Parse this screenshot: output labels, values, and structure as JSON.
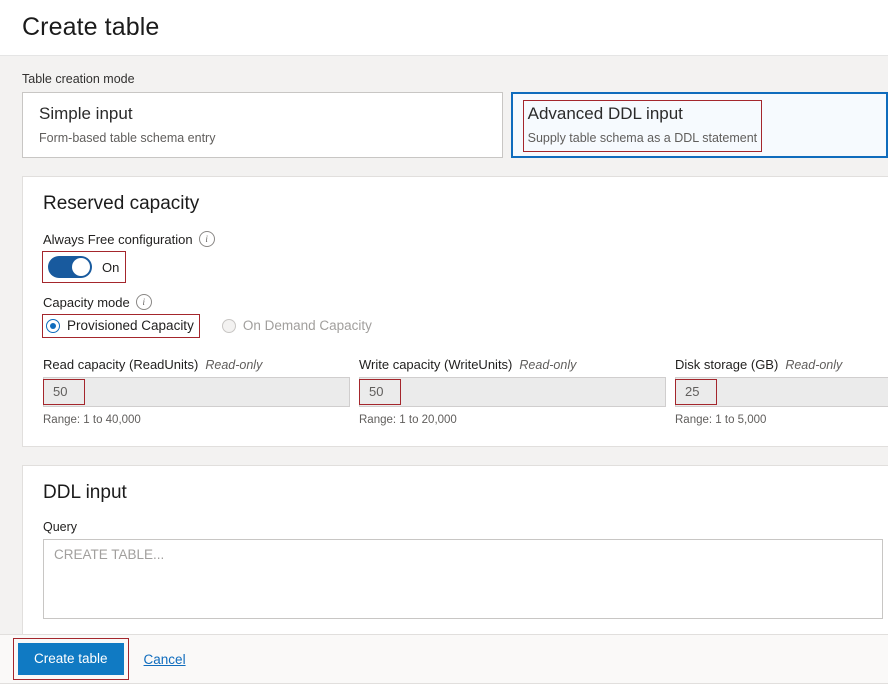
{
  "header": {
    "title": "Create table"
  },
  "mode": {
    "label": "Table creation mode",
    "tiles": [
      {
        "title": "Simple input",
        "subtitle": "Form-based table schema entry",
        "selected": false
      },
      {
        "title": "Advanced DDL input",
        "subtitle": "Supply table schema as a DDL statement",
        "selected": true
      }
    ]
  },
  "reserved_capacity": {
    "title": "Reserved capacity",
    "always_free": {
      "label": "Always Free configuration",
      "info_icon": "info-icon",
      "state": "On"
    },
    "capacity_mode": {
      "label": "Capacity mode",
      "info_icon": "info-icon",
      "options": [
        {
          "label": "Provisioned Capacity",
          "selected": true,
          "disabled": false
        },
        {
          "label": "On Demand Capacity",
          "selected": false,
          "disabled": true
        }
      ]
    },
    "fields": [
      {
        "name": "Read capacity (ReadUnits)",
        "readonly_tag": "Read-only",
        "value": "50",
        "range": "Range: 1 to 40,000"
      },
      {
        "name": "Write capacity (WriteUnits)",
        "readonly_tag": "Read-only",
        "value": "50",
        "range": "Range: 1 to 20,000"
      },
      {
        "name": "Disk storage (GB)",
        "readonly_tag": "Read-only",
        "value": "25",
        "range": "Range: 1 to 5,000"
      }
    ]
  },
  "ddl_input": {
    "title": "DDL input",
    "query_label": "Query",
    "query_value": "",
    "query_placeholder": "CREATE TABLE..."
  },
  "footer": {
    "create_label": "Create table",
    "cancel_label": "Cancel"
  },
  "colors": {
    "accent_blue": "#107ac3",
    "toggle_on": "#185a9e",
    "annotation_red": "#a4262c",
    "selected_tile_border": "#0f6cbd"
  }
}
